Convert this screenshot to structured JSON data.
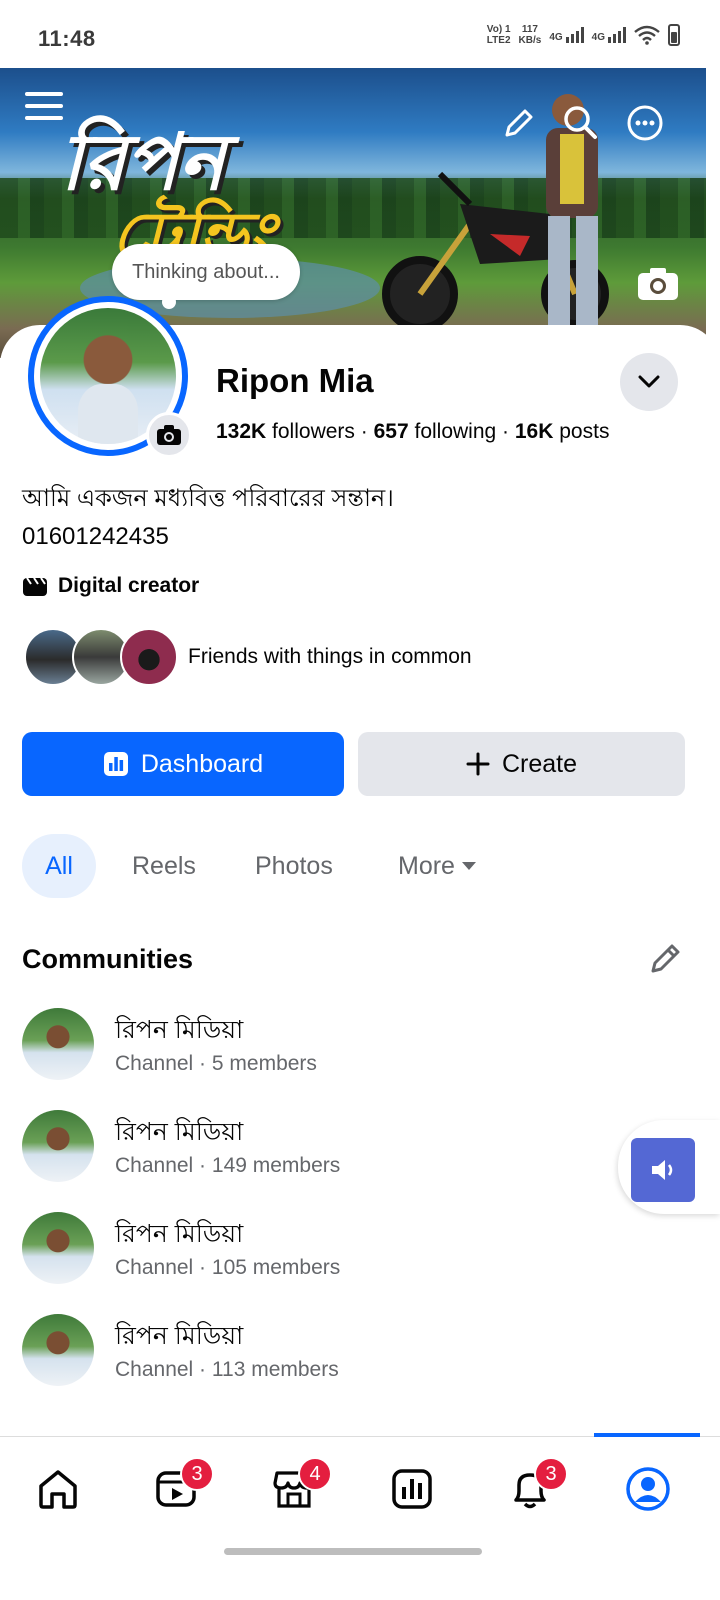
{
  "status_bar": {
    "time": "11:48",
    "volte": "Vo) 1",
    "lte": "LTE2",
    "speed_value": "117",
    "speed_unit": "KB/s",
    "net1": "4G",
    "net2": "4G"
  },
  "cover": {
    "headline_line1": "রিপন",
    "headline_line2": "ট্রেন্ডিং"
  },
  "thinking_bubble": "Thinking about...",
  "profile": {
    "name": "Ripon Mia",
    "followers_count": "132K",
    "followers_label": "followers",
    "following_count": "657",
    "following_label": "following",
    "posts_count": "16K",
    "posts_label": "posts",
    "bio_line1": "আমি একজন মধ্যবিত্ত পরিবারের সন্তান।",
    "bio_line2": "01601242435",
    "category": "Digital creator",
    "friends_text": "Friends with things in common"
  },
  "actions": {
    "dashboard_label": "Dashboard",
    "create_label": "Create"
  },
  "tabs": [
    {
      "label": "All",
      "active": true
    },
    {
      "label": "Reels"
    },
    {
      "label": "Photos"
    },
    {
      "label": "More"
    }
  ],
  "communities": {
    "title": "Communities",
    "items": [
      {
        "name": "রিপন মিডিয়া",
        "meta": "Channel · 5 members"
      },
      {
        "name": "রিপন মিডিয়া",
        "meta": "Channel · 149 members"
      },
      {
        "name": "রিপন মিডিয়া",
        "meta": "Channel · 105 members"
      },
      {
        "name": "রিপন মিডিয়া",
        "meta": "Channel · 113 members"
      }
    ]
  },
  "bottom_nav": {
    "items": [
      {
        "icon": "home-icon"
      },
      {
        "icon": "video-icon",
        "badge": "3"
      },
      {
        "icon": "marketplace-icon",
        "badge": "4"
      },
      {
        "icon": "dashboard-icon"
      },
      {
        "icon": "bell-icon",
        "badge": "3"
      },
      {
        "icon": "profile-icon",
        "active": true
      }
    ]
  },
  "colors": {
    "accent": "#0866ff",
    "badge": "#e41e3f",
    "secondary_text": "#65676b",
    "button_gray": "#e4e6eb"
  }
}
